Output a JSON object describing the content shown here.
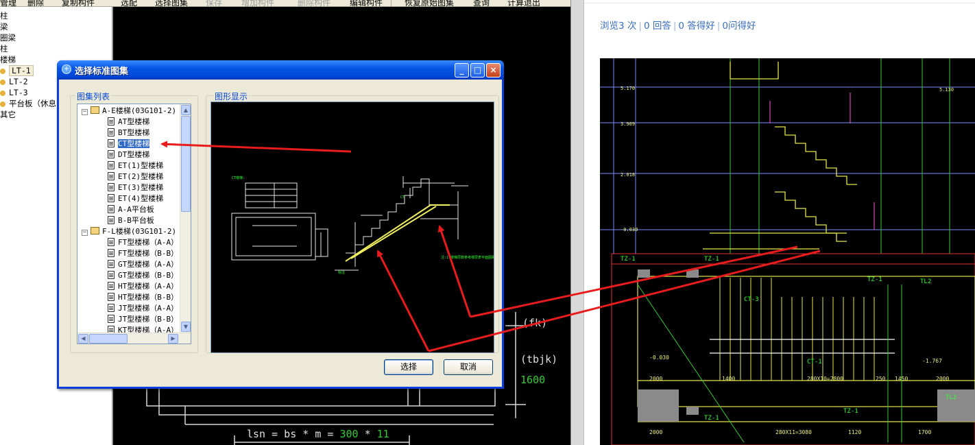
{
  "toolbar": {
    "items": [
      "管理",
      "删除",
      "复制构件",
      "选配",
      "选择图集",
      "保存",
      "增加构件",
      "删除构件",
      "编辑构件",
      "恢复原始图集",
      "查询",
      "计算退出"
    ]
  },
  "tree": {
    "items": [
      "柱",
      "梁",
      "圈梁",
      "柱",
      "楼梯"
    ],
    "stairs": [
      "LT-1",
      "LT-2",
      "LT-3",
      "平台板（休息"
    ],
    "other": "其它"
  },
  "cad": {
    "fk": "(fk)",
    "tbjk": "(tbjk)",
    "tbjk_value": "1600",
    "formula": "lsn = bs * m = ",
    "formula_bs": "300",
    "formula_star": "*",
    "formula_m": "11"
  },
  "dialog": {
    "title": "选择标准图集",
    "list_label": "图集列表",
    "preview_label": "图形显示",
    "group1": "A-E楼梯(03G101-2)",
    "group1_items": [
      "AT型楼梯",
      "BT型楼梯",
      "CT型楼梯",
      "DT型楼梯",
      "ET(1)型楼梯",
      "ET(2)型楼梯",
      "ET(3)型楼梯",
      "ET(4)型楼梯",
      "A-A平台板",
      "B-B平台板"
    ],
    "group2": "F-L楼梯(03G101-2)",
    "group2_items": [
      "FT型楼梯（A-A）",
      "FT型楼梯（B-B）",
      "GT型楼梯（A-A）",
      "GT型楼梯（B-B）",
      "HT型楼梯（A-A）",
      "HT型楼梯（B-B）",
      "JT型楼梯（A-A）",
      "JT型楼梯（B-B）",
      "KT型楼梯（A-A）"
    ],
    "select_button": "选择",
    "cancel_button": "取消",
    "window_buttons": [
      "_",
      "□",
      "×"
    ]
  },
  "web": {
    "views": "浏览3 次",
    "answers": "0 回答",
    "good_answers": "0 答得好",
    "got_good": "0问得好",
    "separator": "|"
  },
  "colors": {
    "arrow": "#e81c1c",
    "titlebar": "#0054e3",
    "link": "#3a6dbe",
    "selection": "#316ac5"
  }
}
